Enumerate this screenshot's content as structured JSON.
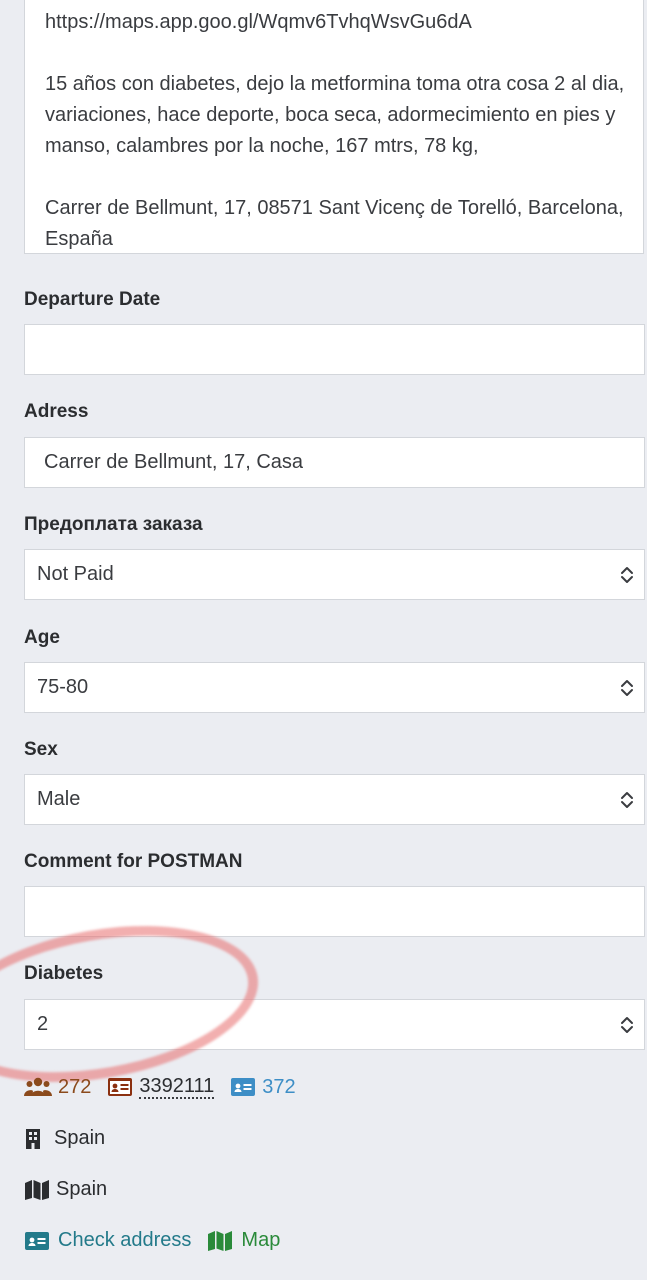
{
  "notes": {
    "lines": [
      "https://maps.app.goo.gl/Wqmv6TvhqWsvGu6dA",
      "",
      "15 años con diabetes, dejo la metformina toma otra cosa 2 al dia, variaciones, hace deporte, boca seca, adormecimiento en pies y manso, calambres por la noche, 167 mtrs, 78 kg,",
      "",
      "Carrer de Bellmunt, 17, 08571 Sant Vicenç de Torelló, Barcelona, España"
    ]
  },
  "departure": {
    "label": "Departure Date",
    "value": ""
  },
  "address": {
    "label": "Adress",
    "value": "Carrer de Bellmunt, 17, Casa"
  },
  "prepayment": {
    "label": "Предоплата заказа",
    "value": "Not Paid"
  },
  "age": {
    "label": "Age",
    "value": "75-80"
  },
  "sex": {
    "label": "Sex",
    "value": "Male"
  },
  "postman": {
    "label": "Comment for POSTMAN",
    "value": ""
  },
  "diabetes": {
    "label": "Diabetes",
    "value": "2"
  },
  "stats": {
    "group_count": "272",
    "card_id": "3392111",
    "card_count": "372"
  },
  "location": {
    "country_building": "Spain",
    "country_map": "Spain"
  },
  "links": {
    "check_address": "Check address",
    "map": "Map"
  },
  "colors": {
    "brown": "#8b4a1c",
    "blue": "#3d8ec6",
    "teal": "#237a8a",
    "green": "#2a8a3a",
    "annotation": "#e86e6e"
  }
}
